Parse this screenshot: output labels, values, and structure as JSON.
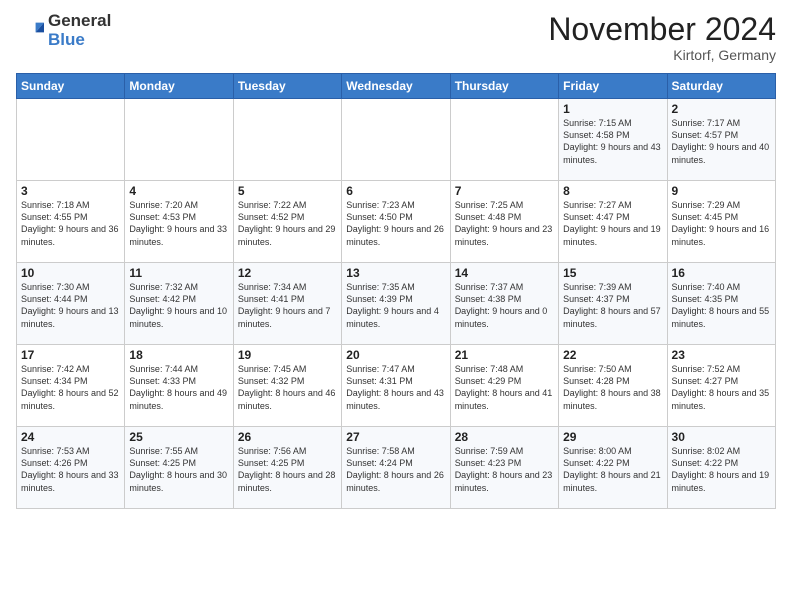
{
  "header": {
    "logo_general": "General",
    "logo_blue": "Blue",
    "month_title": "November 2024",
    "location": "Kirtorf, Germany"
  },
  "days_of_week": [
    "Sunday",
    "Monday",
    "Tuesday",
    "Wednesday",
    "Thursday",
    "Friday",
    "Saturday"
  ],
  "weeks": [
    [
      null,
      null,
      null,
      null,
      null,
      {
        "day": 1,
        "sunrise": "7:15 AM",
        "sunset": "4:58 PM",
        "daylight": "9 hours and 43 minutes."
      },
      {
        "day": 2,
        "sunrise": "7:17 AM",
        "sunset": "4:57 PM",
        "daylight": "9 hours and 40 minutes."
      }
    ],
    [
      {
        "day": 3,
        "sunrise": "7:18 AM",
        "sunset": "4:55 PM",
        "daylight": "9 hours and 36 minutes."
      },
      {
        "day": 4,
        "sunrise": "7:20 AM",
        "sunset": "4:53 PM",
        "daylight": "9 hours and 33 minutes."
      },
      {
        "day": 5,
        "sunrise": "7:22 AM",
        "sunset": "4:52 PM",
        "daylight": "9 hours and 29 minutes."
      },
      {
        "day": 6,
        "sunrise": "7:23 AM",
        "sunset": "4:50 PM",
        "daylight": "9 hours and 26 minutes."
      },
      {
        "day": 7,
        "sunrise": "7:25 AM",
        "sunset": "4:48 PM",
        "daylight": "9 hours and 23 minutes."
      },
      {
        "day": 8,
        "sunrise": "7:27 AM",
        "sunset": "4:47 PM",
        "daylight": "9 hours and 19 minutes."
      },
      {
        "day": 9,
        "sunrise": "7:29 AM",
        "sunset": "4:45 PM",
        "daylight": "9 hours and 16 minutes."
      }
    ],
    [
      {
        "day": 10,
        "sunrise": "7:30 AM",
        "sunset": "4:44 PM",
        "daylight": "9 hours and 13 minutes."
      },
      {
        "day": 11,
        "sunrise": "7:32 AM",
        "sunset": "4:42 PM",
        "daylight": "9 hours and 10 minutes."
      },
      {
        "day": 12,
        "sunrise": "7:34 AM",
        "sunset": "4:41 PM",
        "daylight": "9 hours and 7 minutes."
      },
      {
        "day": 13,
        "sunrise": "7:35 AM",
        "sunset": "4:39 PM",
        "daylight": "9 hours and 4 minutes."
      },
      {
        "day": 14,
        "sunrise": "7:37 AM",
        "sunset": "4:38 PM",
        "daylight": "9 hours and 0 minutes."
      },
      {
        "day": 15,
        "sunrise": "7:39 AM",
        "sunset": "4:37 PM",
        "daylight": "8 hours and 57 minutes."
      },
      {
        "day": 16,
        "sunrise": "7:40 AM",
        "sunset": "4:35 PM",
        "daylight": "8 hours and 55 minutes."
      }
    ],
    [
      {
        "day": 17,
        "sunrise": "7:42 AM",
        "sunset": "4:34 PM",
        "daylight": "8 hours and 52 minutes."
      },
      {
        "day": 18,
        "sunrise": "7:44 AM",
        "sunset": "4:33 PM",
        "daylight": "8 hours and 49 minutes."
      },
      {
        "day": 19,
        "sunrise": "7:45 AM",
        "sunset": "4:32 PM",
        "daylight": "8 hours and 46 minutes."
      },
      {
        "day": 20,
        "sunrise": "7:47 AM",
        "sunset": "4:31 PM",
        "daylight": "8 hours and 43 minutes."
      },
      {
        "day": 21,
        "sunrise": "7:48 AM",
        "sunset": "4:29 PM",
        "daylight": "8 hours and 41 minutes."
      },
      {
        "day": 22,
        "sunrise": "7:50 AM",
        "sunset": "4:28 PM",
        "daylight": "8 hours and 38 minutes."
      },
      {
        "day": 23,
        "sunrise": "7:52 AM",
        "sunset": "4:27 PM",
        "daylight": "8 hours and 35 minutes."
      }
    ],
    [
      {
        "day": 24,
        "sunrise": "7:53 AM",
        "sunset": "4:26 PM",
        "daylight": "8 hours and 33 minutes."
      },
      {
        "day": 25,
        "sunrise": "7:55 AM",
        "sunset": "4:25 PM",
        "daylight": "8 hours and 30 minutes."
      },
      {
        "day": 26,
        "sunrise": "7:56 AM",
        "sunset": "4:25 PM",
        "daylight": "8 hours and 28 minutes."
      },
      {
        "day": 27,
        "sunrise": "7:58 AM",
        "sunset": "4:24 PM",
        "daylight": "8 hours and 26 minutes."
      },
      {
        "day": 28,
        "sunrise": "7:59 AM",
        "sunset": "4:23 PM",
        "daylight": "8 hours and 23 minutes."
      },
      {
        "day": 29,
        "sunrise": "8:00 AM",
        "sunset": "4:22 PM",
        "daylight": "8 hours and 21 minutes."
      },
      {
        "day": 30,
        "sunrise": "8:02 AM",
        "sunset": "4:22 PM",
        "daylight": "8 hours and 19 minutes."
      }
    ]
  ]
}
